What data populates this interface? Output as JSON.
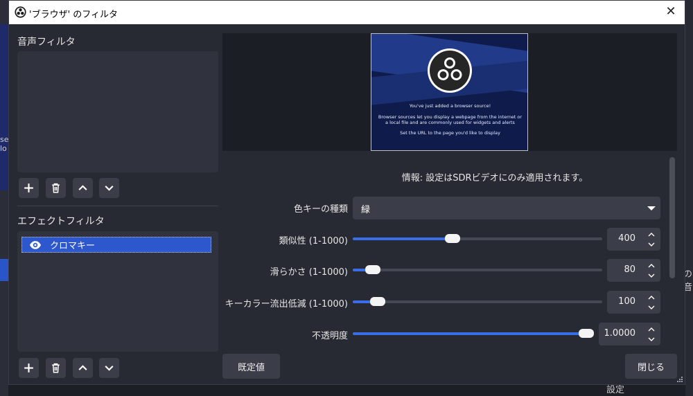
{
  "window": {
    "title": "'ブラウザ' のフィルタ",
    "close_glyph": "✕"
  },
  "background": {
    "left_text_line1": "se",
    "left_text_line2": "lo",
    "right_text": "の音",
    "bottom_text": "設定"
  },
  "audio_filters": {
    "label": "音声フィルタ",
    "items": []
  },
  "effect_filters": {
    "label": "エフェクトフィルタ",
    "items": [
      {
        "label": "クロマキー",
        "visible": true,
        "selected": true
      }
    ]
  },
  "preview": {
    "line1": "You've just added a browser source!",
    "line2": "Browser sources let you display a webpage from the internet or",
    "line3": "a local file and are commonly used for widgets and alerts",
    "line4": "Set the URL to the page you'd like to display"
  },
  "properties": {
    "info": "情報: 設定はSDRビデオにのみ適用されます。",
    "key_type": {
      "label": "色キーの種類",
      "value": "緑"
    },
    "similarity": {
      "label": "類似性 (1-1000)",
      "value": "400",
      "fraction": 0.4
    },
    "smoothness": {
      "label": "滑らかさ (1-1000)",
      "value": "80",
      "fraction": 0.08
    },
    "spill": {
      "label": "キーカラー流出低減 (1-1000)",
      "value": "100",
      "fraction": 0.1
    },
    "opacity": {
      "label": "不透明度",
      "value": "1.0000",
      "fraction": 1.0
    }
  },
  "buttons": {
    "defaults": "既定値",
    "close": "閉じる"
  },
  "colors": {
    "accent": "#3a6ee8",
    "selection": "#2d57cc",
    "panel": "#272a33",
    "button": "#3b3e48"
  },
  "icons": {
    "app": "obs-logo-icon",
    "add": "plus-icon",
    "remove": "trash-icon",
    "move_up": "chevron-up-icon",
    "move_down": "chevron-down-icon",
    "visibility": "eye-icon",
    "dropdown": "caret-down-icon"
  }
}
